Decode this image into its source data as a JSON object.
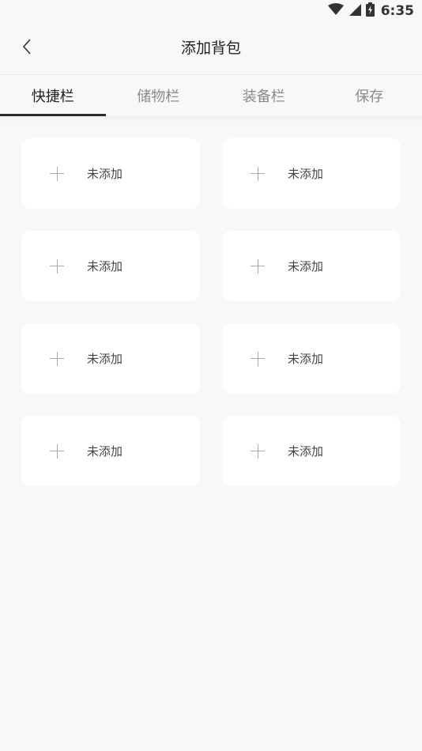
{
  "status_bar": {
    "time": "6:35",
    "icons": [
      "wifi-icon",
      "signal-icon",
      "battery-icon"
    ]
  },
  "header": {
    "title": "添加背包",
    "back_icon": "chevron-left-icon"
  },
  "tabs": [
    {
      "label": "快捷栏",
      "active": true
    },
    {
      "label": "储物栏",
      "active": false
    },
    {
      "label": "装备栏",
      "active": false
    },
    {
      "label": "保存",
      "active": false
    }
  ],
  "slots": [
    {
      "label": "未添加",
      "icon": "plus-icon"
    },
    {
      "label": "未添加",
      "icon": "plus-icon"
    },
    {
      "label": "未添加",
      "icon": "plus-icon"
    },
    {
      "label": "未添加",
      "icon": "plus-icon"
    },
    {
      "label": "未添加",
      "icon": "plus-icon"
    },
    {
      "label": "未添加",
      "icon": "plus-icon"
    },
    {
      "label": "未添加",
      "icon": "plus-icon"
    },
    {
      "label": "未添加",
      "icon": "plus-icon"
    }
  ],
  "colors": {
    "background": "#f8f8f8",
    "card": "#ffffff",
    "active_tab": "#222222",
    "inactive_tab": "#8a8a8a"
  }
}
